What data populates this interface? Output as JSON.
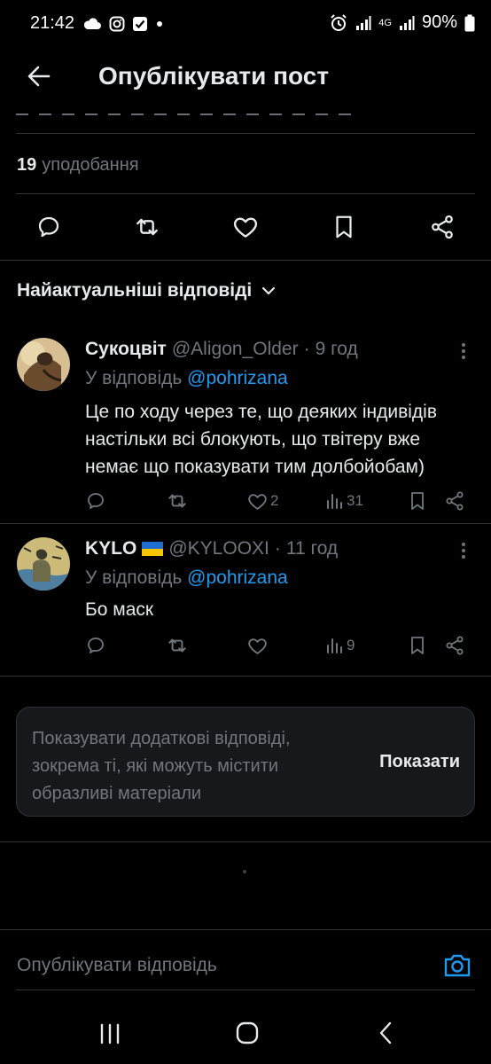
{
  "status_bar": {
    "time": "21:42",
    "battery": "90%",
    "network": "4G"
  },
  "header": {
    "title": "Опублікувати пост"
  },
  "stats": {
    "likes_count": "19",
    "likes_label": "уподобання"
  },
  "post_actions": [
    "reply-icon",
    "retweet-icon",
    "like-icon",
    "bookmark-icon",
    "share-icon"
  ],
  "replies_sort": {
    "label": "Найактуальніші відповіді"
  },
  "replies": [
    {
      "name": "Сукоцвіт",
      "flag": "",
      "handle": "@Aligon_Older",
      "dot": "·",
      "time": "9 год",
      "reply_prefix": "У відповідь",
      "reply_to": "@pohrizana",
      "text": "Це по ходу через те, що деяких індивідів настільки всі блокують, що твітеру вже немає що показувати тим долбойобам)",
      "likes": "2",
      "views": "31"
    },
    {
      "name": "KYLO",
      "flag": "🇺🇦",
      "handle": "@KYLOOXI",
      "dot": "·",
      "time": "11 год",
      "reply_prefix": "У відповідь",
      "reply_to": "@pohrizana",
      "text": "Бо маск",
      "likes": "",
      "views": "9"
    }
  ],
  "more_replies_card": {
    "text": "Показувати додаткові відповіді, зокрема ті, які можуть містити образливі матеріали",
    "button": "Показати"
  },
  "composer": {
    "placeholder": "Опублікувати відповідь"
  },
  "colors": {
    "background": "#000000",
    "text": "#e7e9ea",
    "secondary": "#71767b",
    "accent": "#1d9bf0",
    "divider": "#2f3336"
  }
}
